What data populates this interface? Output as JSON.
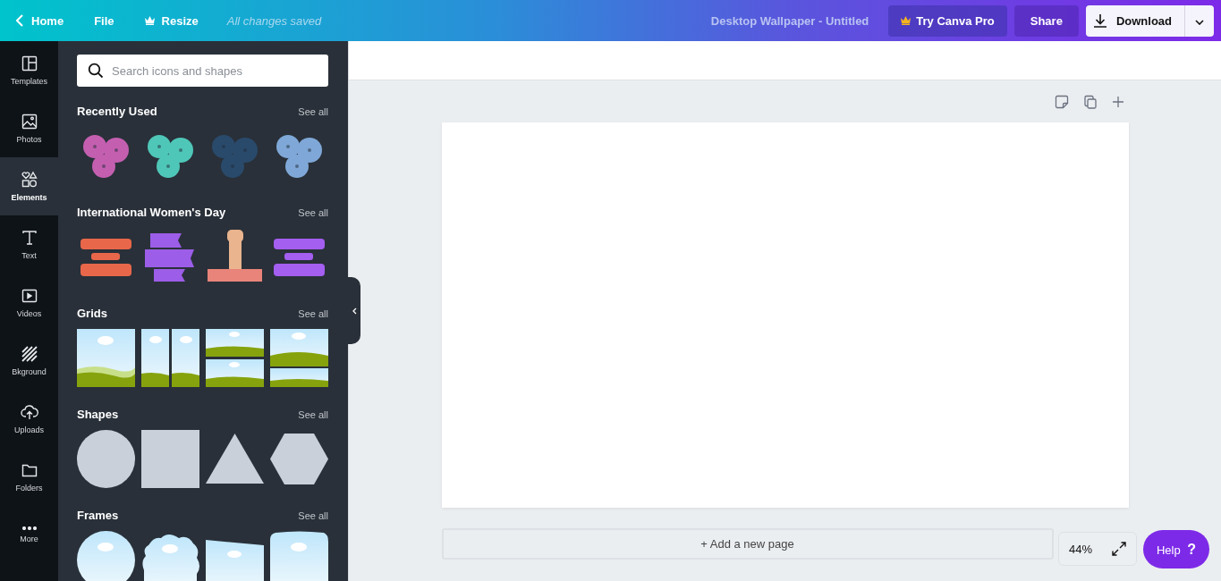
{
  "topbar": {
    "back": "Home",
    "menu": [
      "File",
      "Resize"
    ],
    "save_status": "All changes saved",
    "document_title": "Desktop Wallpaper - Untitled",
    "pro_button": "Try Canva Pro",
    "share_button": "Share",
    "download_button": "Download"
  },
  "rail": [
    {
      "kind": "templates",
      "label": "Templates",
      "selected": false
    },
    {
      "kind": "photos",
      "label": "Photos",
      "selected": false
    },
    {
      "kind": "elements",
      "label": "Elements",
      "selected": true
    },
    {
      "kind": "text",
      "label": "Text",
      "selected": false
    },
    {
      "kind": "videos",
      "label": "Videos",
      "selected": false
    },
    {
      "kind": "background",
      "label": "Bkground",
      "selected": false
    },
    {
      "kind": "uploads",
      "label": "Uploads",
      "selected": false
    },
    {
      "kind": "folders",
      "label": "Folders",
      "selected": false
    },
    {
      "kind": "more",
      "label": "More",
      "selected": false
    }
  ],
  "search": {
    "placeholder": "Search icons and shapes"
  },
  "sections": [
    {
      "title": "Recently Used",
      "see_all": "See all",
      "items": [
        {
          "kind": "flower",
          "color": "#c45fb0"
        },
        {
          "kind": "flower",
          "color": "#4fc7b8"
        },
        {
          "kind": "flower",
          "color": "#2a4a6b"
        },
        {
          "kind": "flower",
          "color": "#7fa8d8"
        }
      ]
    },
    {
      "title": "International Women's Day",
      "see_all": "See all",
      "items": [
        {
          "kind": "lettering",
          "color": "#e8674a"
        },
        {
          "kind": "ribbon",
          "color": "#9c5de8"
        },
        {
          "kind": "fist",
          "color": "#e9b48e"
        },
        {
          "kind": "lettering",
          "color": "#a45ef0"
        }
      ]
    },
    {
      "title": "Grids",
      "see_all": "See all",
      "items": [
        {
          "kind": "grid-single"
        },
        {
          "kind": "grid-columns"
        },
        {
          "kind": "grid-rows"
        },
        {
          "kind": "grid-uneven"
        }
      ]
    },
    {
      "title": "Shapes",
      "see_all": "See all",
      "items": [
        {
          "kind": "circle"
        },
        {
          "kind": "square"
        },
        {
          "kind": "triangle"
        },
        {
          "kind": "hexagon"
        }
      ]
    },
    {
      "title": "Frames",
      "see_all": "See all",
      "items": [
        {
          "kind": "frame-circle"
        },
        {
          "kind": "frame-cloud"
        },
        {
          "kind": "frame-slant"
        },
        {
          "kind": "frame-rounded"
        }
      ]
    }
  ],
  "canvas": {
    "add_page": "+ Add a new page",
    "zoom": "44%",
    "help_button": "Help",
    "help_icon": "?"
  }
}
